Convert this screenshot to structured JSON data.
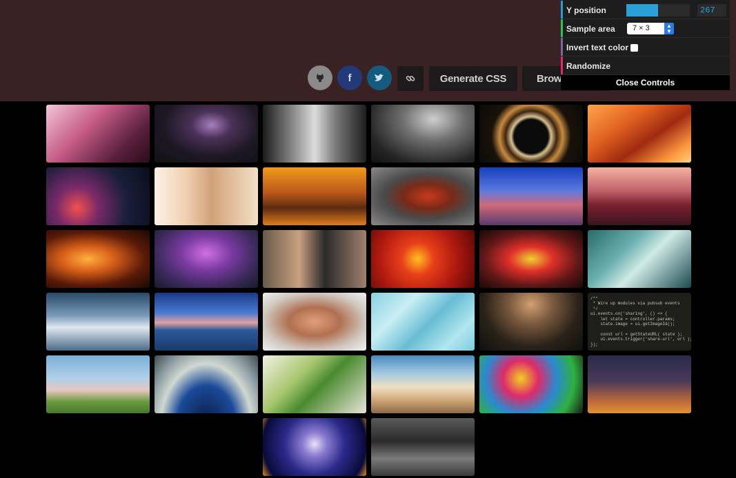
{
  "toolbar": {
    "generate_css_label": "Generate CSS",
    "browse_label": "Browse",
    "icons": [
      "github-icon",
      "facebook-icon",
      "twitter-icon",
      "link-icon"
    ]
  },
  "controls": {
    "y_position_label": "Y position",
    "y_position_value": "267",
    "y_position_fraction": 0.5,
    "sample_area_label": "Sample area",
    "sample_area_value": "7 × 3",
    "invert_text_color_label": "Invert text color",
    "randomize_label": "Randomize",
    "close_label": "Close Controls"
  },
  "code_thumbnail": {
    "lines": [
      "/**",
      " * Wire up modules via pubsub events",
      " */",
      "ui.events.on('sharing', () => {",
      "    let state = controller.params;",
      "    state.image = ui.getImageId();",
      "",
      "    const url = getStateURL( state );",
      "    ui.events.trigger('share-url', url );",
      "});"
    ]
  },
  "gallery": [
    {
      "name": "concert-crowd-pink",
      "bg": "linear-gradient(135deg,#f4c6d6 0%,#c45a86 40%,#5a1f3c 75%,#2a0d1c 100%)"
    },
    {
      "name": "lightning-storm",
      "bg": "radial-gradient(ellipse at 55% 35%,#a77fbf 0%,#4b3258 25%,#1d1824 60%,#111114 100%)"
    },
    {
      "name": "skyscrapers-bw",
      "bg": "linear-gradient(90deg,#1c1c1c 0%,#8c8c8c 30%,#dcdcdc 50%,#7a7a7a 70%,#1e1e1e 100%)"
    },
    {
      "name": "concert-crowd-bw",
      "bg": "radial-gradient(ellipse at 60% 25%,#cfcfcf 0%,#6f6f6f 35%,#252525 75%,#121212 100%)"
    },
    {
      "name": "light-trails-circle",
      "bg": "radial-gradient(circle at 50% 55%,#0b0b0b 0%,#0b0b0b 28%,#d8c090 33%,#3c2510 42%,#c88a40 52%,#1a120a 65%,#0a0a0a 100%)"
    },
    {
      "name": "antelope-canyon",
      "bg": "linear-gradient(145deg,#ffa54a 0%,#e06020 35%,#a02a10 60%,#ff9a40 85%,#ffd080 100%)"
    },
    {
      "name": "bokeh-city-lights",
      "bg": "radial-gradient(circle at 30% 70%,#f45050 0%,#7a2a6a 25%,#1a1f3a 60%,#0b0d1c 100%)"
    },
    {
      "name": "girls-whispering",
      "bg": "linear-gradient(90deg,#fbf3e6 0%,#f1d0b0 30%,#d2a27a 55%,#f4e0c6 100%)"
    },
    {
      "name": "autumn-trees",
      "bg": "linear-gradient(180deg,#f09a1a 0%,#b8561a 45%,#5c2a10 70%,#e07c1c 100%)"
    },
    {
      "name": "red-sports-car",
      "bg": "radial-gradient(ellipse at 55% 50%,#c83a1c 0%,#7a2a18 30%,#4a4a4a 55%,#8a8a8a 100%)"
    },
    {
      "name": "colorful-building-sunset",
      "bg": "linear-gradient(180deg,#1840c0 0%,#5a7ae0 40%,#d06a7a 65%,#5a3a6a 100%)"
    },
    {
      "name": "volcano-mountains",
      "bg": "linear-gradient(180deg,#f7b0a0 0%,#c0626a 40%,#7a2030 65%,#3a1520 100%)"
    },
    {
      "name": "light-streaks-orange",
      "bg": "radial-gradient(ellipse at 40% 50%,#ffb040 0%,#d8601a 30%,#5a1a08 65%,#1a0804 100%)"
    },
    {
      "name": "supertree-grove",
      "bg": "radial-gradient(ellipse at 50% 40%,#d070e0 0%,#7a3aa0 35%,#3a2a5a 70%,#1a1a2a 100%)"
    },
    {
      "name": "pool-party",
      "bg": "linear-gradient(90deg,#6a5a4a 0%,#c8a080 35%,#2a2a2a 60%,#a08070 100%)"
    },
    {
      "name": "red-dahlias",
      "bg": "radial-gradient(circle at 45% 50%,#ffc020 0%,#e8401a 25%,#b01a10 60%,#5a0808 100%)"
    },
    {
      "name": "neon-light-painting",
      "bg": "radial-gradient(ellipse at 50% 50%,#f0d030 0%,#e0302a 30%,#601818 65%,#1a0808 100%)"
    },
    {
      "name": "ocean-wave",
      "bg": "linear-gradient(135deg,#2a6a6a 0%,#6ab0b0 35%,#d0eae6 55%,#1a4a50 100%)"
    },
    {
      "name": "dramatic-clouds",
      "bg": "linear-gradient(180deg,#2a4a6a 0%,#7a9ab8 40%,#e0e8f0 60%,#4a6a8a 100%)"
    },
    {
      "name": "pier-sunset",
      "bg": "linear-gradient(180deg,#1a3a8a 0%,#4a7ad0 35%,#e0a0a0 52%,#2a5a9a 65%,#1a3a6a 100%)"
    },
    {
      "name": "woman-sunglasses",
      "bg": "radial-gradient(ellipse at 50% 50%,#e0a080 0%,#b07050 35%,#d0c8c0 70%,#f0f0f0 100%)"
    },
    {
      "name": "pool-water",
      "bg": "linear-gradient(135deg,#8ad0e0 0%,#c8eef4 30%,#6abcd4 55%,#b0e6f0 80%,#7acce0 100%)"
    },
    {
      "name": "silhouette-trees-sky",
      "bg": "radial-gradient(ellipse at 50% 20%,#d0a070 0%,#7a5a40 30%,#2a2218 65%,#101010 100%)"
    },
    {
      "name": "code-snippet",
      "bg": "#1e1f1a"
    },
    {
      "name": "lone-tree-field",
      "bg": "linear-gradient(180deg,#7ab0d8 0%,#b0d0e8 40%,#e8c8c0 60%,#6a9a40 80%,#4a7a2a 100%)"
    },
    {
      "name": "earth-from-space",
      "bg": "radial-gradient(ellipse at 50% 120%,#0a1a40 0%,#1a4a9a 40%,#d0d8d0 62%,#8a9aa0 80%,#404a50 100%)"
    },
    {
      "name": "potted-plant",
      "bg": "linear-gradient(135deg,#f4f0e4 0%,#a8c870 35%,#4a8a30 55%,#e8e4d8 100%)"
    },
    {
      "name": "above-clouds",
      "bg": "linear-gradient(180deg,#4a8ac0 0%,#a0c8e0 30%,#f0e0c0 55%,#c8a070 80%,#8a6a4a 100%)"
    },
    {
      "name": "rainbow-roses",
      "bg": "radial-gradient(circle at 40% 40%,#f0d020 0%,#e02a6a 25%,#2a8ad0 50%,#30b040 75%,#1a1a1a 100%)"
    },
    {
      "name": "dusk-sky",
      "bg": "linear-gradient(180deg,#2a2a4a 0%,#4a3a5a 45%,#c06a3a 80%,#e0903a 100%)"
    },
    {
      "name": "fireworks",
      "bg": "radial-gradient(circle at 50% 45%,#e8e0f8 0%,#8a7ad0 20%,#2a2a8a 50%,#0a0a3a 85%,#e0901a 100%)"
    },
    {
      "name": "crowd-bw",
      "bg": "linear-gradient(180deg,#5a5a5a 0%,#2a2a2a 40%,#7a7a7a 70%,#3a3a3a 100%)"
    }
  ]
}
